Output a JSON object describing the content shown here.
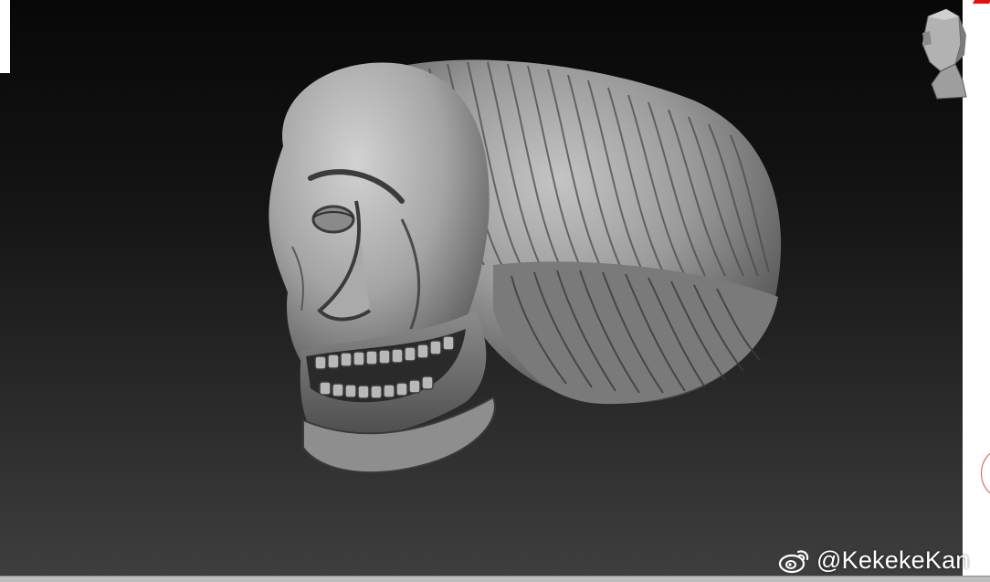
{
  "viewport": {
    "background_top": "#080808",
    "background_bottom": "#3e3e3e",
    "model_name": "sculpt-model-worm-head"
  },
  "navigation": {
    "icon": "head-navigation-icon"
  },
  "watermark": {
    "icon": "weibo-logo-icon",
    "handle": "@KekekeKan"
  },
  "colors": {
    "clay": "#9a9a9a",
    "accent_red": "#e01010"
  }
}
